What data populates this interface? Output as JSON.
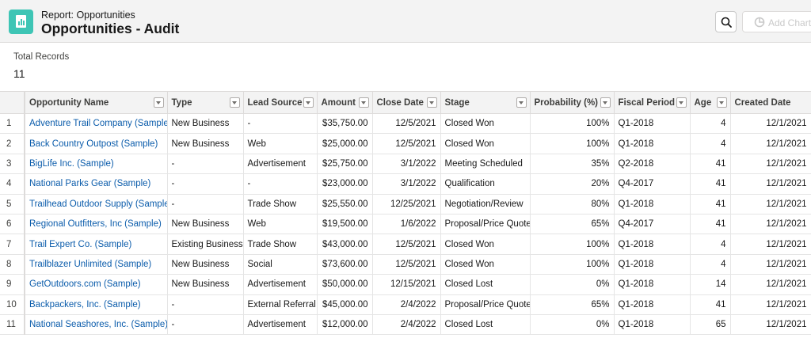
{
  "header": {
    "eyebrow": "Report: Opportunities",
    "title": "Opportunities - Audit",
    "add_chart_label": "Add Chart"
  },
  "summary": {
    "label": "Total Records",
    "value": "11"
  },
  "table": {
    "columns": [
      "Opportunity Name",
      "Type",
      "Lead Source",
      "Amount",
      "Close Date",
      "Stage",
      "Probability (%)",
      "Fiscal Period",
      "Age",
      "Created Date"
    ],
    "rows": [
      [
        "1",
        "Adventure Trail Company (Sample)",
        "New Business",
        "-",
        "$35,750.00",
        "12/5/2021",
        "Closed Won",
        "100%",
        "Q1-2018",
        "4",
        "12/1/2021"
      ],
      [
        "2",
        "Back Country Outpost (Sample)",
        "New Business",
        "Web",
        "$25,000.00",
        "12/5/2021",
        "Closed Won",
        "100%",
        "Q1-2018",
        "4",
        "12/1/2021"
      ],
      [
        "3",
        "BigLife Inc. (Sample)",
        "-",
        "Advertisement",
        "$25,750.00",
        "3/1/2022",
        "Meeting Scheduled",
        "35%",
        "Q2-2018",
        "41",
        "12/1/2021"
      ],
      [
        "4",
        "National Parks Gear (Sample)",
        "-",
        "-",
        "$23,000.00",
        "3/1/2022",
        "Qualification",
        "20%",
        "Q4-2017",
        "41",
        "12/1/2021"
      ],
      [
        "5",
        "Trailhead Outdoor Supply (Sample)",
        "-",
        "Trade Show",
        "$25,550.00",
        "12/25/2021",
        "Negotiation/Review",
        "80%",
        "Q1-2018",
        "41",
        "12/1/2021"
      ],
      [
        "6",
        "Regional Outfitters, Inc (Sample)",
        "New Business",
        "Web",
        "$19,500.00",
        "1/6/2022",
        "Proposal/Price Quote",
        "65%",
        "Q4-2017",
        "41",
        "12/1/2021"
      ],
      [
        "7",
        "Trail Expert Co. (Sample)",
        "Existing Business",
        "Trade Show",
        "$43,000.00",
        "12/5/2021",
        "Closed Won",
        "100%",
        "Q1-2018",
        "4",
        "12/1/2021"
      ],
      [
        "8",
        "Trailblazer Unlimited (Sample)",
        "New Business",
        "Social",
        "$73,600.00",
        "12/5/2021",
        "Closed Won",
        "100%",
        "Q1-2018",
        "4",
        "12/1/2021"
      ],
      [
        "9",
        "GetOutdoors.com (Sample)",
        "New Business",
        "Advertisement",
        "$50,000.00",
        "12/15/2021",
        "Closed Lost",
        "0%",
        "Q1-2018",
        "14",
        "12/1/2021"
      ],
      [
        "10",
        "Backpackers, Inc. (Sample)",
        "-",
        "External Referral",
        "$45,000.00",
        "2/4/2022",
        "Proposal/Price Quote",
        "65%",
        "Q1-2018",
        "41",
        "12/1/2021"
      ],
      [
        "11",
        "National Seashores, Inc. (Sample)",
        "-",
        "Advertisement",
        "$12,000.00",
        "2/4/2022",
        "Closed Lost",
        "0%",
        "Q1-2018",
        "65",
        "12/1/2021"
      ]
    ]
  },
  "colors": {
    "icon_bg": "#3ec5b5",
    "link": "#0b5cab",
    "header_bg": "#f3f3f3"
  }
}
